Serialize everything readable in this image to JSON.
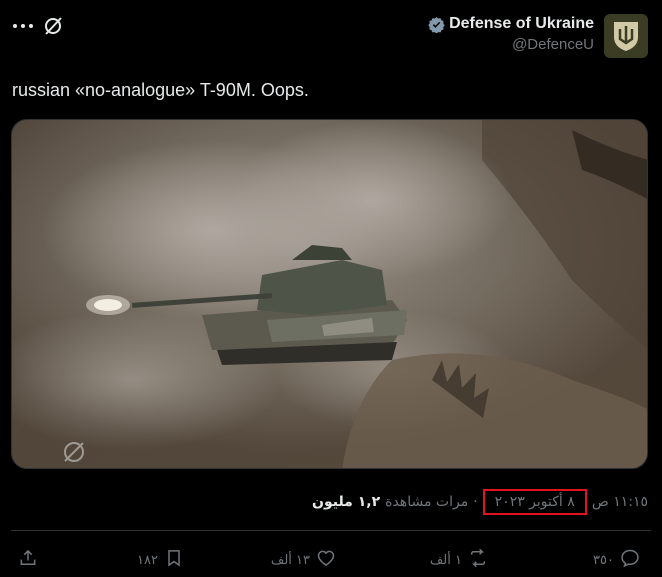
{
  "author": {
    "display_name": "Defense of Ukraine",
    "handle": "@DefenceU"
  },
  "tweet": {
    "text": "russian «no-analogue» T-90M. Oops."
  },
  "meta": {
    "time": "١١:١٥ ص",
    "date": "٨ أكتوبر ٢٠٢٣",
    "views_count": "١,٢ مليون",
    "views_label": "مرات مشاهدة",
    "separator": "·"
  },
  "actions": {
    "replies": "٣٥٠",
    "reposts": "١ ألف",
    "likes": "١٣ ألف",
    "bookmarks": "١٨٢"
  },
  "icons": {
    "more": "more-icon",
    "grok": "grok-icon",
    "verified": "verified-icon",
    "reply": "reply-icon",
    "repost": "repost-icon",
    "like": "like-icon",
    "bookmark": "bookmark-icon",
    "share": "share-icon"
  },
  "colors": {
    "background": "#000000",
    "text": "#e7e9ea",
    "secondary": "#71767b",
    "highlight_box": "#e0141e",
    "verified": "#829aab"
  }
}
